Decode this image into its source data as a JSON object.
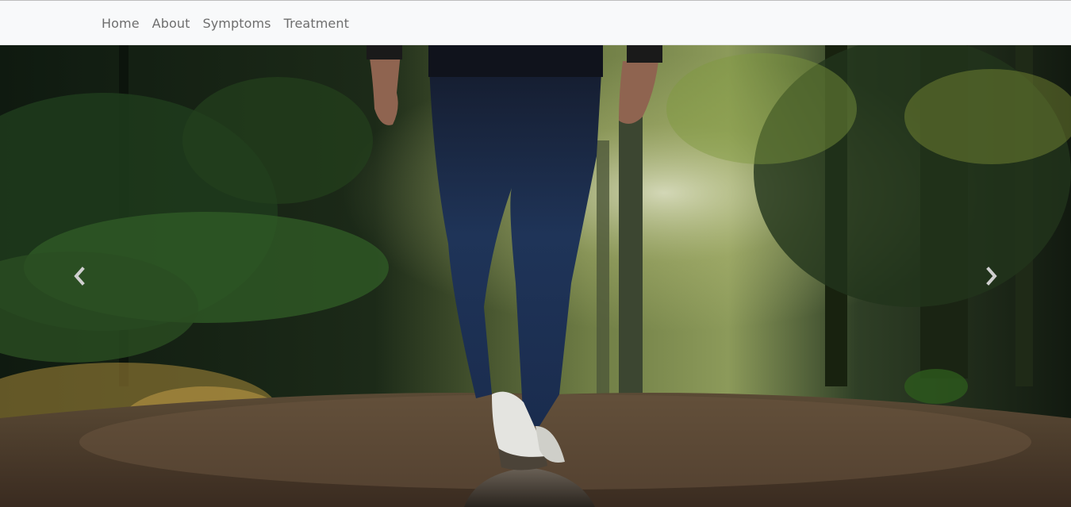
{
  "navbar": {
    "links": [
      {
        "label": "Home"
      },
      {
        "label": "About"
      },
      {
        "label": "Symptoms"
      },
      {
        "label": "Treatment"
      }
    ]
  },
  "carousel": {
    "prev_icon": "chevron-left-icon",
    "next_icon": "chevron-right-icon"
  },
  "colors": {
    "navbar_bg": "#f8f9fa",
    "nav_text": "#6e6e6e",
    "control": "#cfcfcf"
  }
}
